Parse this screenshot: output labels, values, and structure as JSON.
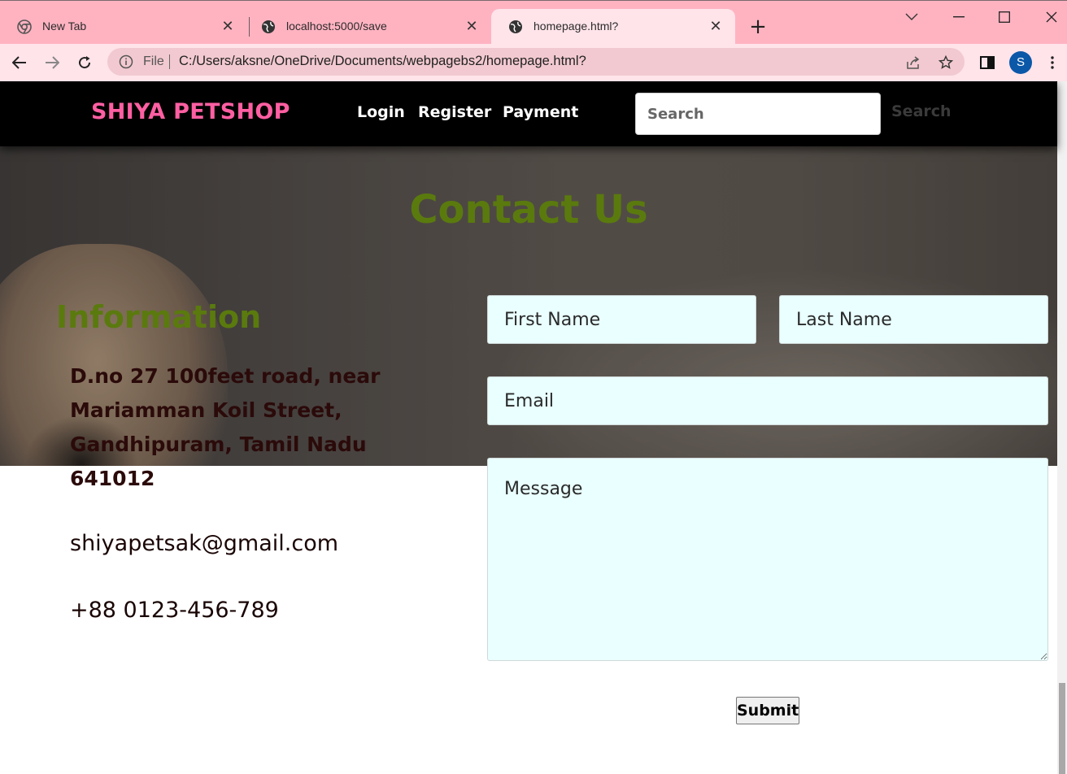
{
  "browser": {
    "tabs": [
      {
        "title": "New Tab",
        "icon": "chrome-icon",
        "active": false
      },
      {
        "title": "localhost:5000/save",
        "icon": "globe-icon",
        "active": false
      },
      {
        "title": "homepage.html?",
        "icon": "globe-icon",
        "active": true
      }
    ],
    "file_label": "File",
    "url": "C:/Users/aksne/OneDrive/Documents/webpagebs2/homepage.html?",
    "profile_initial": "S",
    "colors": {
      "tabstrip": "#ffb3c1",
      "toolbar": "#ffe4ea",
      "omnibox": "#f2c9d0",
      "avatar": "#0b57a8"
    }
  },
  "navbar": {
    "brand": "SHIYA PETSHOP",
    "links": [
      "Login",
      "Register",
      "Payment"
    ],
    "search_placeholder": "Search",
    "search_button": "Search",
    "colors": {
      "background": "#000000",
      "brand": "#ff5fa2"
    }
  },
  "contact": {
    "title": "Contact Us",
    "info_title": "Information",
    "address": "D.no 27 100feet road, near Mariamman Koil Street, Gandhipuram, Tamil Nadu 641012",
    "email": "shiyapetsak@gmail.com",
    "phone": "+88 0123-456-789",
    "colors": {
      "heading": "#5a7a0e",
      "text": "#1a0505",
      "field_bg": "#eaffff"
    }
  },
  "form": {
    "first_name_placeholder": "First Name",
    "last_name_placeholder": "Last Name",
    "email_placeholder": "Email",
    "message_placeholder": "Message",
    "submit_label": "Submit"
  }
}
